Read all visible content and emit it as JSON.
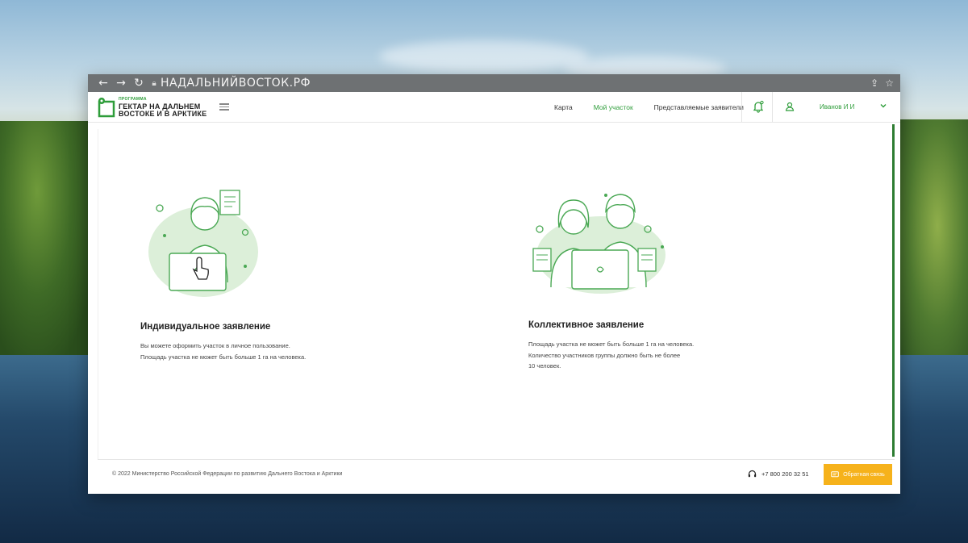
{
  "browser": {
    "url": "НАДАЛЬНИЙВОСТОК.РФ",
    "back_icon": "arrow-left-icon",
    "forward_icon": "arrow-right-icon",
    "reload_icon": "reload-icon",
    "lock_icon": "lock-icon",
    "share_icon": "share-icon",
    "bookmark_icon": "star-icon"
  },
  "header": {
    "logo_small": "ПРОГРАММА",
    "logo_line1": "ГЕКТАР НА ДАЛЬНЕМ",
    "logo_line2": "ВОСТОКЕ И В АРКТИКЕ",
    "nav": [
      {
        "label": "Карта",
        "active": false
      },
      {
        "label": "Мой участок",
        "active": true
      },
      {
        "label": "Представляемые заявители",
        "active": false
      }
    ],
    "user_name": "Иванов И И"
  },
  "cards": [
    {
      "title": "Индивидуальное заявление",
      "lines": [
        "Вы можете оформить участок в личное пользование.",
        "Площадь участка не может быть больше 1 га на человека."
      ]
    },
    {
      "title": "Коллективное заявление",
      "lines": [
        "Площадь участка не может быть больше 1 га на человека.",
        "Количество участников группы должно быть не более",
        "10 человек."
      ]
    }
  ],
  "footer": {
    "copyright": "© 2022 Министерство Российской Федерации по развитию Дальнего Востока и Арктики",
    "phone": "+7 800 200 32 51",
    "feedback_label": "Обратная связь"
  },
  "colors": {
    "brand_green": "#2e9d3a",
    "feedback_yellow": "#f6b21b"
  }
}
